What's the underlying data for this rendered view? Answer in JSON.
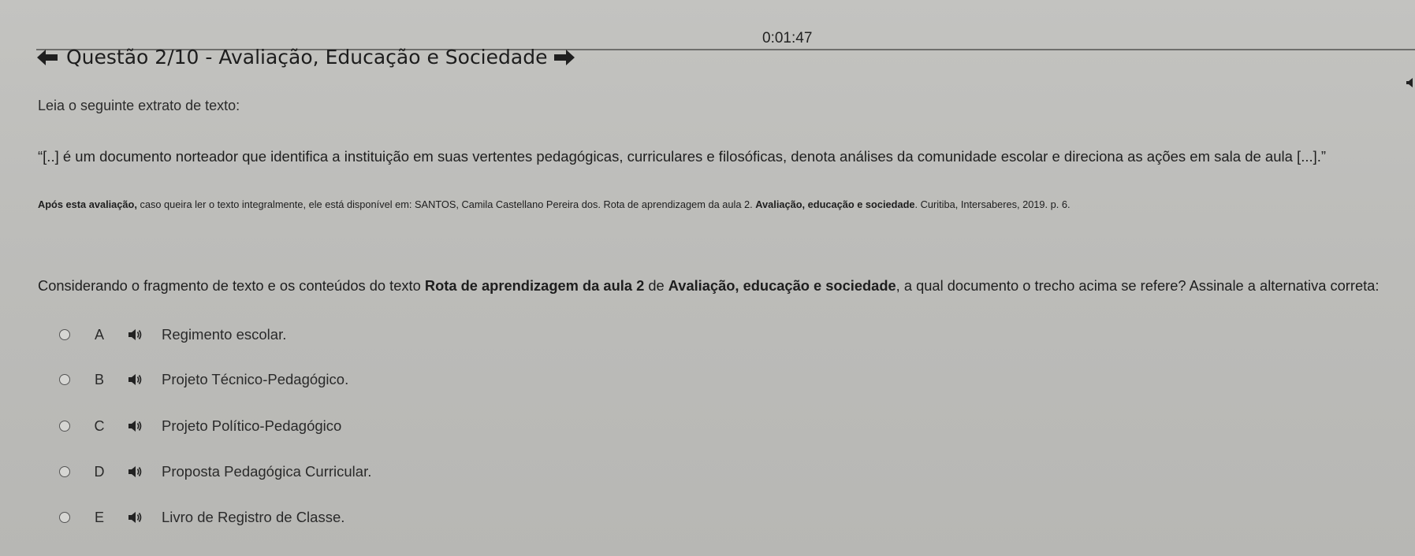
{
  "timer": "0:01:47",
  "header": {
    "title": "Questão 2/10 - Avaliação, Educação e Sociedade",
    "prev_icon": "arrow-left-icon",
    "next_icon": "arrow-right-icon"
  },
  "intro": "Leia o seguinte extrato de texto:",
  "quote": "“[..] é um documento norteador que identifica a instituição em suas vertentes pedagógicas, curriculares e filosóficas, denota análises da comunidade escolar e direciona as ações em sala de aula [...].”",
  "source": {
    "lead": "Após esta avaliação,",
    "text1": " caso queira ler o texto integralmente, ele está disponível em: SANTOS, Camila Castellano Pereira dos. Rota de aprendizagem da aula 2. ",
    "bold": "Avaliação, educação e sociedade",
    "text2": ". Curitiba, Intersaberes, 2019. p. 6."
  },
  "question": {
    "part1": "Considerando o fragmento de texto e os conteúdos do texto ",
    "bold1": "Rota de aprendizagem da aula 2",
    "part2": " de ",
    "bold2": "Avaliação, educação e sociedade",
    "part3": ", a qual documento o trecho acima se refere? Assinale a alternativa correta:"
  },
  "options": [
    {
      "letter": "A",
      "text": "Regimento escolar."
    },
    {
      "letter": "B",
      "text": "Projeto Técnico-Pedagógico."
    },
    {
      "letter": "C",
      "text": "Projeto Político-Pedagógico"
    },
    {
      "letter": "D",
      "text": "Proposta Pedagógica Curricular."
    },
    {
      "letter": "E",
      "text": "Livro de Registro de Classe."
    }
  ],
  "icons": {
    "radio": "radio-unselected-icon",
    "speaker": "speaker-icon"
  }
}
